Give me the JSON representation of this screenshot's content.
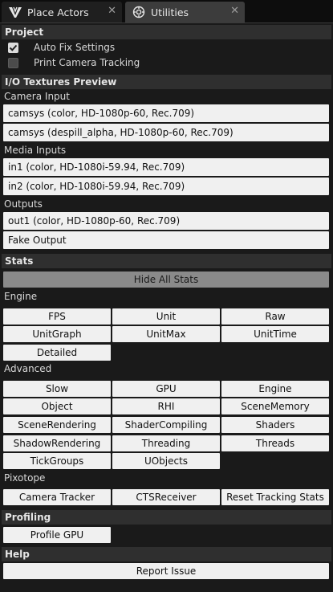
{
  "tabs": [
    {
      "label": "Place Actors",
      "icon": "place-actors-icon",
      "close": "✕"
    },
    {
      "label": "Utilities",
      "icon": "utilities-icon",
      "close": "✕"
    }
  ],
  "project": {
    "header": "Project",
    "auto_fix": {
      "label": "Auto Fix Settings",
      "checked": true
    },
    "print_camera": {
      "label": "Print Camera Tracking",
      "checked": false
    }
  },
  "io": {
    "header": "I/O Textures Preview",
    "camera_input_label": "Camera Input",
    "camera_inputs": [
      "camsys (color, HD-1080p-60, Rec.709)",
      "camsys (despill_alpha, HD-1080p-60, Rec.709)"
    ],
    "media_inputs_label": "Media Inputs",
    "media_inputs": [
      "in1 (color, HD-1080i-59.94, Rec.709)",
      "in2 (color, HD-1080i-59.94, Rec.709)"
    ],
    "outputs_label": "Outputs",
    "outputs": [
      "out1 (color, HD-1080p-60, Rec.709)",
      "Fake Output"
    ]
  },
  "stats": {
    "header": "Stats",
    "hide_all": "Hide All Stats",
    "engine_label": "Engine",
    "engine": [
      "FPS",
      "Unit",
      "Raw",
      "UnitGraph",
      "UnitMax",
      "UnitTime",
      "Detailed"
    ],
    "advanced_label": "Advanced",
    "advanced": [
      "Slow",
      "GPU",
      "Engine",
      "Object",
      "RHI",
      "SceneMemory",
      "SceneRendering",
      "ShaderCompiling",
      "Shaders",
      "ShadowRendering",
      "Threading",
      "Threads",
      "TickGroups",
      "UObjects"
    ],
    "pixotope_label": "Pixotope",
    "pixotope": [
      "Camera Tracker",
      "CTSReceiver",
      "Reset Tracking Stats"
    ]
  },
  "profiling": {
    "header": "Profiling",
    "profile_gpu": "Profile GPU"
  },
  "help": {
    "header": "Help",
    "report_issue": "Report Issue"
  }
}
